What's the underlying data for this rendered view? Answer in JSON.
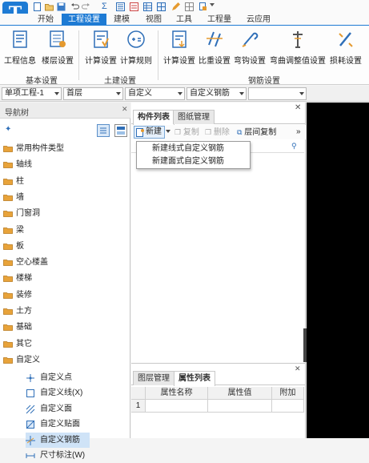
{
  "logo_letter": "T",
  "menu": {
    "tabs": [
      "开始",
      "工程设置",
      "建模",
      "视图",
      "工具",
      "工程量",
      "云应用"
    ],
    "active": "工程设置"
  },
  "ribbon": {
    "buttons": {
      "project_info": "工程信息",
      "floor_settings": "楼层设置",
      "calc_settings": "计算设置",
      "calc_rules": "计算规则",
      "rebar_calc_settings": "计算设置",
      "ratio_settings": "比重设置",
      "hook_settings": "弯钩设置",
      "curve_adjust_settings": "弯曲调整值设置",
      "loss_settings": "损耗设置"
    },
    "groups": {
      "basic": "基本设置",
      "civil": "土建设置",
      "rebar": "钢筋设置"
    }
  },
  "dropdowns": {
    "unit": "单项工程-1",
    "floor": "首层",
    "category": "自定义",
    "subcategory": "自定义钢筋",
    "element": ""
  },
  "nav": {
    "title": "导航树",
    "folders": [
      "常用构件类型",
      "轴线",
      "柱",
      "墙",
      "门窗洞",
      "梁",
      "板",
      "空心楼盖",
      "楼梯",
      "装修",
      "土方",
      "基础",
      "其它",
      "自定义"
    ],
    "custom_items": [
      "自定义点",
      "自定义线(X)",
      "自定义面",
      "自定义贴面",
      "自定义钢筋",
      "尺寸标注(W)"
    ],
    "selected": "自定义钢筋"
  },
  "component_panel": {
    "tabs": [
      "构件列表",
      "图纸管理"
    ],
    "active_tab": "构件列表",
    "toolbar": {
      "new": "新建",
      "copy": "复制",
      "delete": "删除",
      "floor_copy": "层间复制",
      "more": "»"
    },
    "new_menu": [
      "新建线式自定义钢筋",
      "新建面式自定义钢筋"
    ]
  },
  "property_panel": {
    "tabs": [
      "图层管理",
      "属性列表"
    ],
    "active_tab": "属性列表",
    "columns": [
      "属性名称",
      "属性值",
      "附加"
    ],
    "rows": [
      {
        "index": "1",
        "name": "",
        "value": "",
        "extra": ""
      }
    ]
  },
  "colors": {
    "accent": "#1e7bd4",
    "folder": "#e8a33a",
    "selected_bg": "#cfe3f7"
  }
}
